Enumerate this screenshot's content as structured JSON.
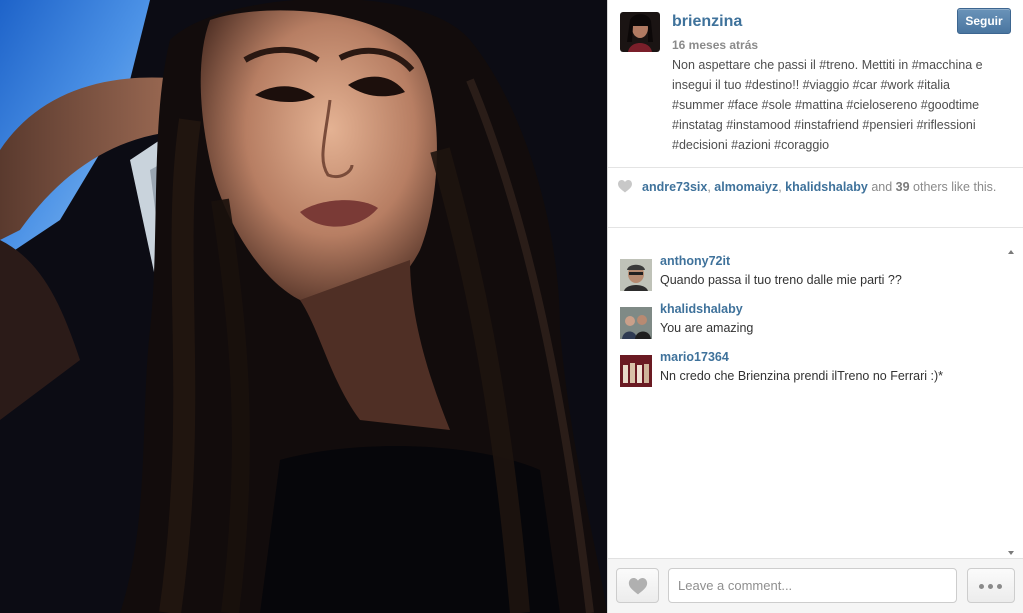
{
  "post": {
    "owner": "brienzina",
    "follow_label": "Seguir",
    "time_ago": "16 meses atrás",
    "caption": "Non aspettare che passi il #treno. Mettiti in #macchina e insegui il tuo #destino!! #viaggio #car #work #italia #summer #face #sole #mattina #cielosereno #goodtime #instatag #instamood #instafriend #pensieri #riflessioni #decisioni #azioni #coraggio"
  },
  "likes": {
    "users": [
      "andre73six",
      "almomaiyz",
      "khalidshalaby"
    ],
    "sep": ", ",
    "and_text": " and ",
    "others_count": "39",
    "others_text": " others like this."
  },
  "comments": [
    {
      "user": "anthony72it",
      "text": "Quando passa il tuo treno dalle mie parti ??"
    },
    {
      "user": "khalidshalaby",
      "text": "You are amazing"
    },
    {
      "user": "mario17364",
      "text": "Nn credo che Brienzina prendi ilTreno no Ferrari :)*"
    }
  ],
  "footer": {
    "comment_placeholder": "Leave a comment...",
    "like_icon": "heart-icon",
    "more_icon": "more-dots-icon"
  },
  "colors": {
    "username": "#3f729b",
    "follow_button": "#4a76a0"
  }
}
